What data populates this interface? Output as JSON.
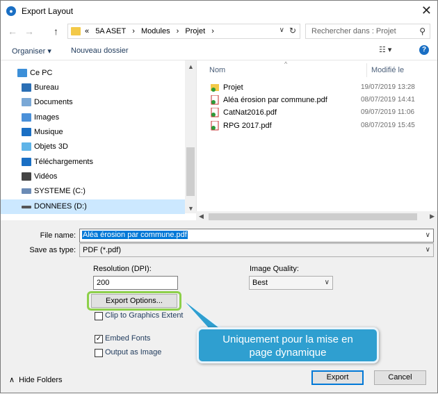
{
  "window": {
    "title": "Export Layout",
    "close_glyph": "✕"
  },
  "nav": {
    "back": "←",
    "forward": "→",
    "up": "↑",
    "breadcrumbs": [
      "«",
      "5A ASET",
      "›",
      "Modules",
      "›",
      "Projet",
      "›"
    ],
    "search_placeholder": "Rechercher dans : Projet"
  },
  "toolbar": {
    "organize": "Organiser ▾",
    "new_folder": "Nouveau dossier",
    "view": "☷ ▾",
    "help": "?"
  },
  "sidebar": {
    "items": [
      {
        "label": "Ce PC",
        "icon": "computer-icon",
        "color": "#3c8fd8"
      },
      {
        "label": "Bureau",
        "icon": "desktop-icon",
        "color": "#2b6fb5"
      },
      {
        "label": "Documents",
        "icon": "documents-icon",
        "color": "#7aa8d6"
      },
      {
        "label": "Images",
        "icon": "pictures-icon",
        "color": "#4a90d9"
      },
      {
        "label": "Musique",
        "icon": "music-icon",
        "color": "#1a6fc4"
      },
      {
        "label": "Objets 3D",
        "icon": "3d-objects-icon",
        "color": "#5fb4e8"
      },
      {
        "label": "Téléchargements",
        "icon": "downloads-icon",
        "color": "#1a6fc4"
      },
      {
        "label": "Vidéos",
        "icon": "videos-icon",
        "color": "#444444"
      },
      {
        "label": "SYSTEME (C:)",
        "icon": "drive-icon",
        "color": "#6b8bb5"
      },
      {
        "label": "DONNEES (D:)",
        "icon": "drive-icon",
        "color": "#555555"
      }
    ]
  },
  "files": {
    "col_name": "Nom",
    "col_date": "Modifié le",
    "rows": [
      {
        "name": "Projet",
        "date": "19/07/2019 13:28",
        "icon": "folder-icon"
      },
      {
        "name": "Aléa érosion par commune.pdf",
        "date": "08/07/2019 14:41",
        "icon": "pdf-icon"
      },
      {
        "name": "CatNat2016.pdf",
        "date": "09/07/2019 11:06",
        "icon": "pdf-icon"
      },
      {
        "name": "RPG 2017.pdf",
        "date": "08/07/2019 15:45",
        "icon": "pdf-icon"
      }
    ]
  },
  "form": {
    "file_name_label": "File name:",
    "file_name_value": "Aléa érosion par commune.pdf",
    "save_type_label": "Save as type:",
    "save_type_value": "PDF (*.pdf)",
    "resolution_label": "Resolution (DPI):",
    "resolution_value": "200",
    "quality_label": "Image Quality:",
    "quality_value": "Best",
    "export_options": "Export Options...",
    "clip_label": "Clip to Graphics Extent",
    "embed_label": "Embed Fonts",
    "output_image_label": "Output as Image",
    "hide_folders": "Hide Folders",
    "export": "Export",
    "cancel": "Cancel"
  },
  "callout": {
    "line1": "Uniquement pour la mise en",
    "line2": "page dynamique"
  }
}
